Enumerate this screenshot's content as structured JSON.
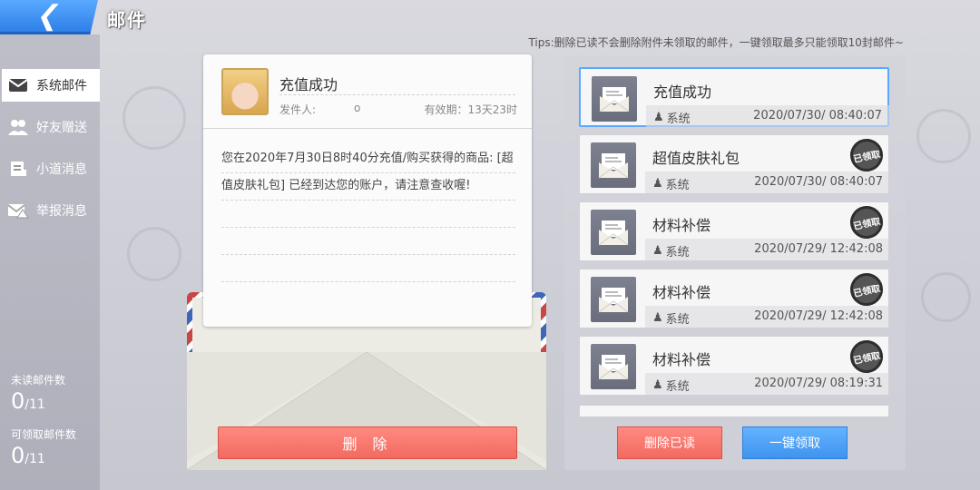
{
  "header": {
    "back_icon": "back-arrow-icon",
    "title": "邮件",
    "tips": "Tips:删除已读不会删除附件未领取的邮件，一键领取最多只能领取10封邮件~"
  },
  "sidebar": {
    "items": [
      {
        "label": "系统邮件",
        "icon": "envelope-icon",
        "active": true
      },
      {
        "label": "好友赠送",
        "icon": "friends-icon",
        "active": false
      },
      {
        "label": "小道消息",
        "icon": "news-icon",
        "active": false
      },
      {
        "label": "举报消息",
        "icon": "report-icon",
        "active": false
      }
    ],
    "unread_label": "未读邮件数",
    "unread_count": "0",
    "unread_total": "/11",
    "claimable_label": "可领取邮件数",
    "claimable_count": "0",
    "claimable_total": "/11"
  },
  "letter": {
    "subject": "充值成功",
    "sender_label": "发件人:",
    "sender_value": "o",
    "expiry": "有效期：13天23时",
    "body": "您在2020年7月30日8时40分充值/购买获得的商品: [超值皮肤礼包] 已经到达您的账户，请注意查收喔!",
    "delete_label": "删 除"
  },
  "mail_list": [
    {
      "title": "充值成功",
      "sender": "系统",
      "time": "2020/07/30/ 08:40:07",
      "claimed": false,
      "selected": true
    },
    {
      "title": "超值皮肤礼包",
      "sender": "系统",
      "time": "2020/07/30/ 08:40:07",
      "claimed": true,
      "selected": false
    },
    {
      "title": "材料补偿",
      "sender": "系统",
      "time": "2020/07/29/ 12:42:08",
      "claimed": true,
      "selected": false
    },
    {
      "title": "材料补偿",
      "sender": "系统",
      "time": "2020/07/29/ 12:42:08",
      "claimed": true,
      "selected": false
    },
    {
      "title": "材料补偿",
      "sender": "系统",
      "time": "2020/07/29/ 08:19:31",
      "claimed": true,
      "selected": false
    }
  ],
  "stamp_text": "已领取",
  "buttons": {
    "mark_read": "删除已读",
    "claim_all": "一键领取"
  },
  "colors": {
    "accent_blue": "#3f93ee",
    "accent_red": "#f26a60"
  }
}
